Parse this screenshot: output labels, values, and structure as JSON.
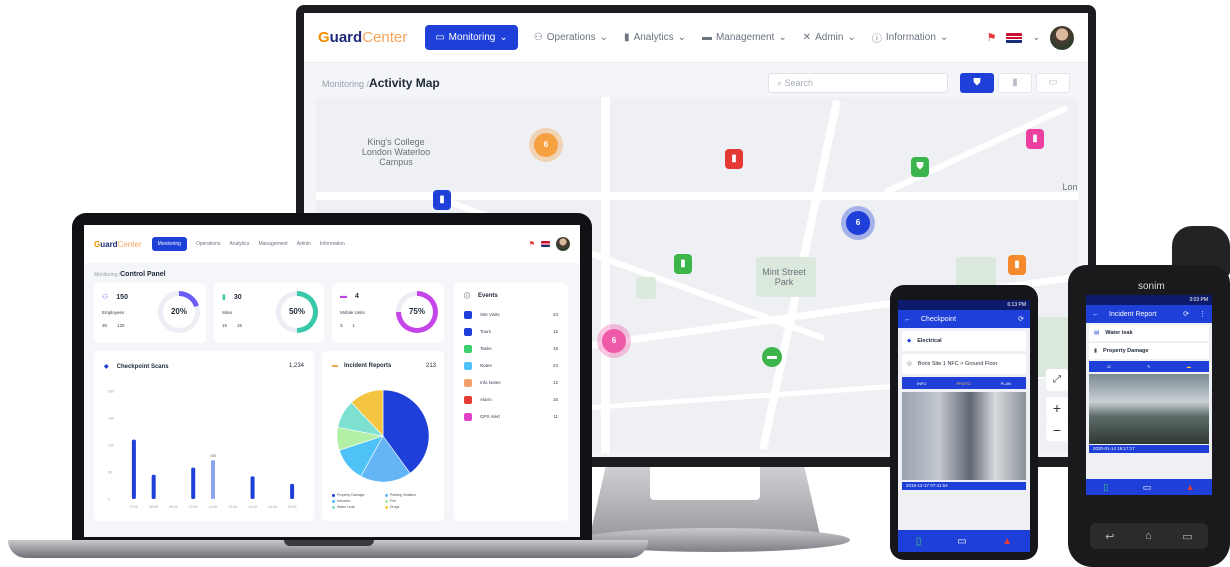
{
  "monitor": {
    "logo": {
      "g": "G",
      "uard": "uard",
      "center": "Center"
    },
    "nav": [
      {
        "label": "Monitoring",
        "icon": "monitor-icon"
      },
      {
        "label": "Operations",
        "icon": "people-icon"
      },
      {
        "label": "Analytics",
        "icon": "bars-icon"
      },
      {
        "label": "Management",
        "icon": "briefcase-icon"
      },
      {
        "label": "Admin",
        "icon": "tools-icon"
      },
      {
        "label": "Information",
        "icon": "info-icon"
      }
    ],
    "breadcrumb_parent": "Monitoring /",
    "page_title": "Activity Map",
    "search_placeholder": "Search",
    "map_labels": {
      "kings_college": "King's College London Waterloo Campus",
      "mint_street_park": "Mint Street Park",
      "lon": "Lon"
    },
    "clusters": [
      "6",
      "6",
      "6"
    ],
    "zoom_in": "+",
    "zoom_out": "−"
  },
  "laptop": {
    "logo": {
      "g": "G",
      "uard": "uard",
      "center": "Center"
    },
    "nav": [
      "Monitoring",
      "Operations",
      "Analytics",
      "Management",
      "Admin",
      "Information"
    ],
    "breadcrumb_parent": "Monitoring /",
    "page_title": "Control Panel",
    "stats": [
      {
        "label": "Employees",
        "value": "150",
        "sub1": "30",
        "sub2": "120",
        "percent": "20%",
        "percent_value": 20,
        "color": "#6b5cf6"
      },
      {
        "label": "Sites",
        "value": "30",
        "sub1": "15",
        "sub2": "15",
        "percent": "50%",
        "percent_value": 50,
        "color": "#38c7a8"
      },
      {
        "label": "Mobile Units",
        "value": "4",
        "sub1": "3",
        "sub2": "1",
        "percent": "75%",
        "percent_value": 75,
        "color": "#c545e8"
      }
    ],
    "events_title": "Events",
    "events": [
      {
        "label": "Site Visits",
        "count": "23",
        "color": "#1e3fd8"
      },
      {
        "label": "Tours",
        "count": "12",
        "color": "#1e3fd8"
      },
      {
        "label": "Tasks",
        "count": "15",
        "color": "#3ccf6b"
      },
      {
        "label": "Notes",
        "count": "23",
        "color": "#4fc3f7"
      },
      {
        "label": "Info Notes",
        "count": "12",
        "color": "#f2a06b"
      },
      {
        "label": "Alarm",
        "count": "15",
        "color": "#e53935"
      },
      {
        "label": "GPS Alert",
        "count": "11",
        "color": "#e040c8"
      }
    ],
    "checkpoint": {
      "title": "Checkpoint Scans",
      "total": "1,234",
      "yticks": [
        "200",
        "150",
        "100",
        "50",
        "0"
      ],
      "xticks": [
        "07:00",
        "08:00",
        "09:00",
        "10:00",
        "11:00",
        "12:00",
        "13:00",
        "14:00",
        "15:00"
      ],
      "bar_value_label": "100"
    },
    "incident": {
      "title": "Incident Reports",
      "total": "213",
      "legend": [
        {
          "label": "Property Damage",
          "color": "#1e3fd8"
        },
        {
          "label": "Parking Violation",
          "color": "#64b5f6"
        },
        {
          "label": "Intrusion",
          "color": "#4fc3f7"
        },
        {
          "label": "Fire",
          "color": "#b2f0a8"
        },
        {
          "label": "Water Leak",
          "color": "#7ee0d0"
        },
        {
          "label": "Drugs",
          "color": "#f5c542"
        }
      ]
    }
  },
  "chart_data": [
    {
      "type": "bar",
      "title": "Checkpoint Scans",
      "categories": [
        "07:00",
        "08:00",
        "09:00",
        "10:00",
        "11:00",
        "12:00",
        "13:00",
        "14:00",
        "15:00"
      ],
      "values": [
        110,
        45,
        0,
        58,
        72,
        0,
        42,
        0,
        28
      ],
      "ylim": [
        0,
        200
      ]
    },
    {
      "type": "pie",
      "title": "Incident Reports",
      "categories": [
        "Property Damage",
        "Parking Violation",
        "Intrusion",
        "Fire",
        "Water Leak",
        "Drugs"
      ],
      "values": [
        40,
        18,
        12,
        8,
        10,
        12
      ]
    }
  ],
  "phone1": {
    "title": "Checkpoint",
    "status": "6:13 PM",
    "item1": "Electrical",
    "item2": "Boris Site 1 NFC > Ground Floor",
    "tabs": [
      "INFO",
      "PHOTO",
      "PLAN"
    ],
    "timestamp": "2019-12-17 07:41:54"
  },
  "phone2": {
    "brand": "sonim",
    "title": "Incident Report",
    "status": "3:03 PM",
    "item1": "Water leak",
    "item2": "Property Damage",
    "timestamp": "2020-01-14 16:17:17"
  }
}
